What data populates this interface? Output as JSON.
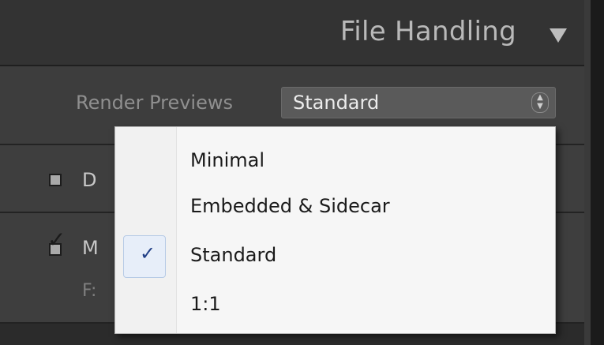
{
  "panel": {
    "title": "File Handling"
  },
  "render_previews": {
    "label": "Render Previews",
    "selected": "Standard"
  },
  "rows": {
    "row2_text": "D",
    "row3_text": "M",
    "row3_sub": "F:"
  },
  "menu": {
    "items": [
      {
        "label": "Minimal"
      },
      {
        "label": "Embedded & Sidecar"
      },
      {
        "label": "Standard",
        "checked": true
      },
      {
        "label": "1:1"
      }
    ]
  },
  "colors": {
    "panel_bg": "#3d3d3d",
    "menu_bg": "#f6f6f6",
    "check_blue": "#213f86"
  }
}
